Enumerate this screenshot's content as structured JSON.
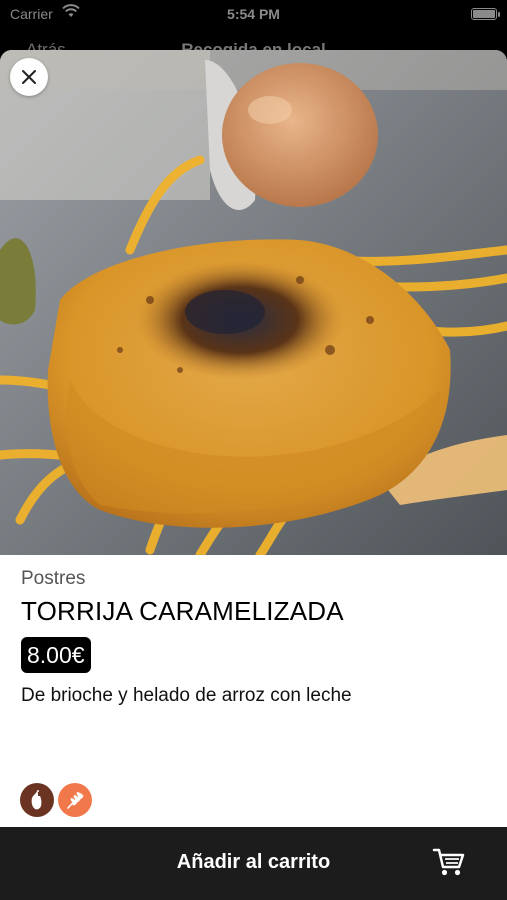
{
  "status_bar": {
    "carrier": "Carrier",
    "time": "5:54 PM"
  },
  "nav_behind": {
    "back_label": "Atrás",
    "title": "Recogida en local"
  },
  "product": {
    "category": "Postres",
    "name": "TORRIJA CARAMELIZADA",
    "price": "8.00€",
    "description": "De brioche y helado de arroz con leche",
    "allergens": [
      "milk-icon",
      "gluten-icon"
    ]
  },
  "actions": {
    "add_to_cart_label": "Añadir al carrito"
  },
  "icons": {
    "close": "close-icon",
    "cart": "cart-icon",
    "wifi": "wifi-icon",
    "battery": "battery-icon"
  },
  "colors": {
    "price_badge": "#000000",
    "bottom_bar": "#1c1c1c",
    "milk_allergen": "#6b3422",
    "gluten_allergen": "#f0784a"
  }
}
